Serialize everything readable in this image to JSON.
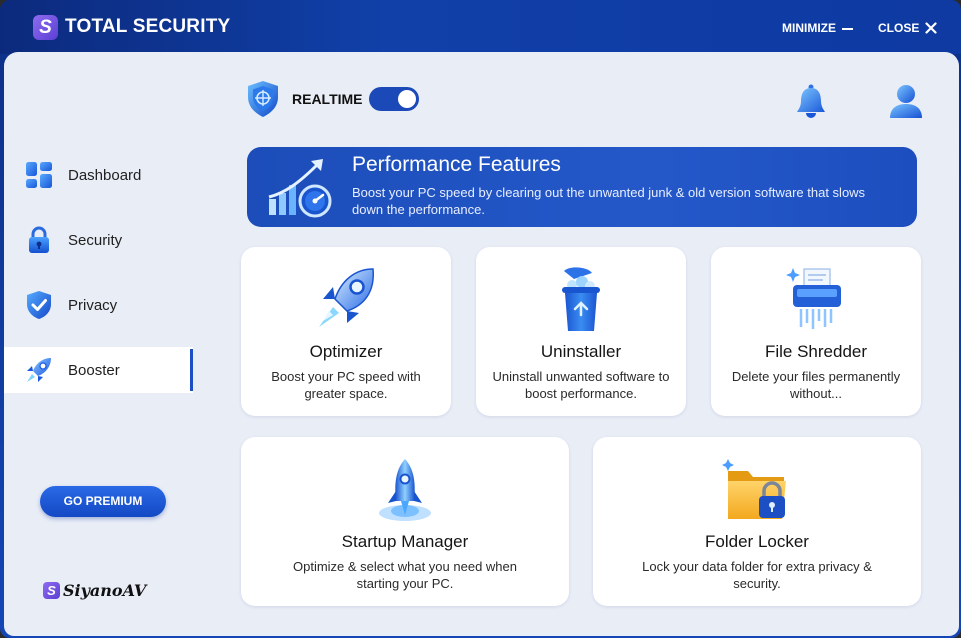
{
  "app": {
    "logo_letter": "S",
    "title": "TOTAL SECURITY",
    "minimize_label": "MINIMIZE",
    "close_label": "CLOSE"
  },
  "sidebar": {
    "items": [
      {
        "label": "Dashboard",
        "icon": "dashboard-icon",
        "active": false
      },
      {
        "label": "Security",
        "icon": "lock-icon",
        "active": false
      },
      {
        "label": "Privacy",
        "icon": "shield-check-icon",
        "active": false
      },
      {
        "label": "Booster",
        "icon": "rocket-icon",
        "active": true
      }
    ],
    "premium_label": "GO PREMIUM",
    "brand_letter": "S",
    "brand_name": "SiyanoAV"
  },
  "header": {
    "realtime_label": "REALTIME",
    "realtime_on": true
  },
  "banner": {
    "title": "Performance Features",
    "description": "Boost your PC speed by clearing out the unwanted junk & old version software that slows down the performance."
  },
  "cards": [
    {
      "title": "Optimizer",
      "description": "Boost your PC speed with greater space.",
      "icon": "rocket-icon"
    },
    {
      "title": "Uninstaller",
      "description": "Uninstall unwanted software to boost performance.",
      "icon": "recycle-bin-icon"
    },
    {
      "title": "File Shredder",
      "description": "Delete your files permanently without...",
      "icon": "shredder-icon"
    },
    {
      "title": "Startup Manager",
      "description": "Optimize & select what you need when starting your PC.",
      "icon": "rocket-launch-icon"
    },
    {
      "title": "Folder Locker",
      "description": "Lock your data folder for extra privacy & security.",
      "icon": "locked-folder-icon"
    }
  ],
  "colors": {
    "accent": "#1c4db9",
    "titlebar": "#0e3aa2",
    "panel_bg": "#e9edf6",
    "card_bg": "#ffffff"
  }
}
